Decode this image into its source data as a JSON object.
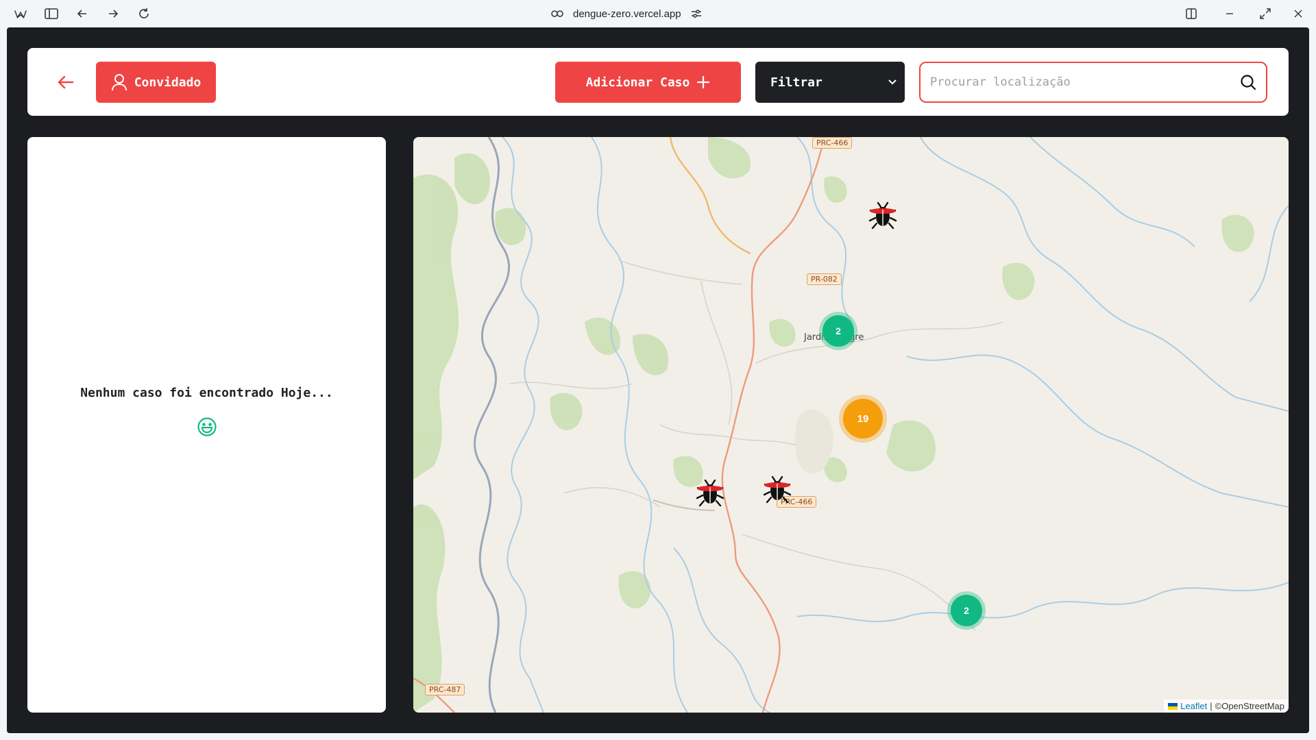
{
  "browser": {
    "url": "dengue-zero.vercel.app"
  },
  "header": {
    "user_label": "Convidado",
    "add_case_label": "Adicionar Caso",
    "filter_label": "Filtrar",
    "search_placeholder": "Procurar localização"
  },
  "sidebar": {
    "empty_message": "Nenhum caso foi encontrado Hoje..."
  },
  "map": {
    "clusters": [
      {
        "count": "2",
        "color": "#10b981"
      },
      {
        "count": "19",
        "color": "#f59e0b"
      },
      {
        "count": "2",
        "color": "#10b981"
      }
    ],
    "road_labels": [
      "PRC-466",
      "PR-082",
      "PRC-466",
      "PRC-487"
    ],
    "town_label": "Jardim Alegre",
    "attribution": {
      "leaflet": "Leaflet",
      "separator": "|",
      "osm": "©OpenStreetMap"
    }
  },
  "colors": {
    "accent": "#ef4444",
    "dark": "#1c1d20",
    "cluster_small": "#10b981",
    "cluster_large": "#f59e0b"
  }
}
